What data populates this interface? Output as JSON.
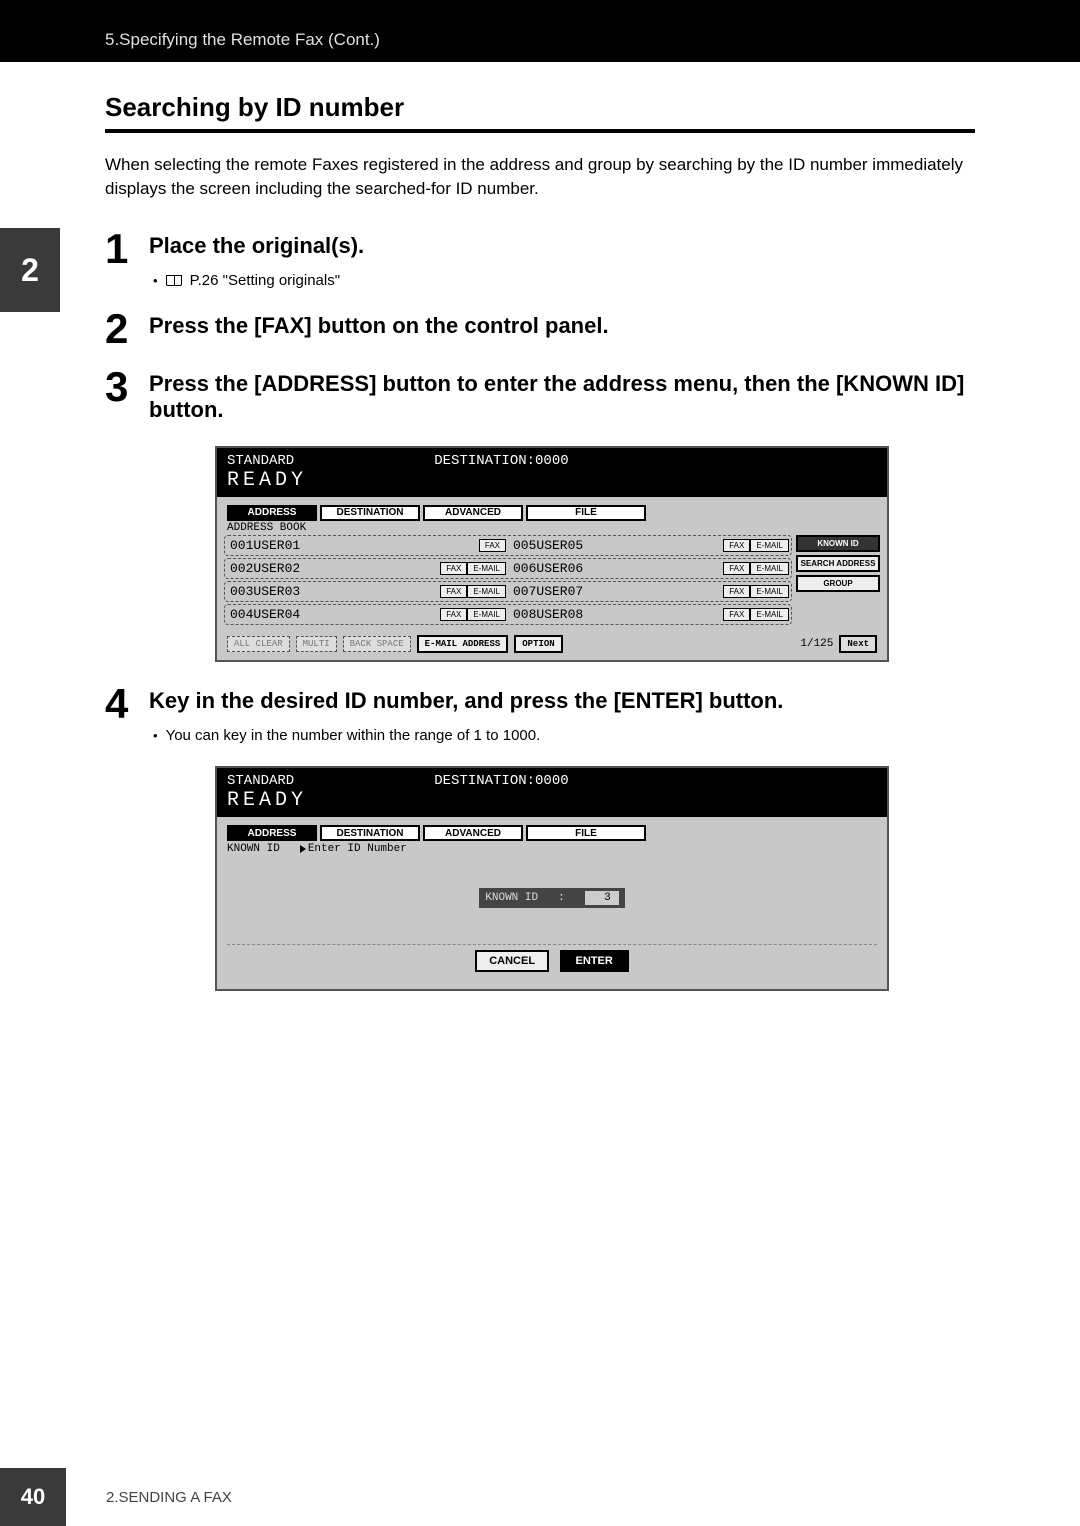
{
  "header": {
    "breadcrumb": "5.Specifying the Remote Fax (Cont.)"
  },
  "section": {
    "number": "2",
    "title": "Searching by ID number",
    "intro": "When selecting the remote Faxes registered in the address and group by searching by the ID number immediately displays the screen including the searched-for ID number."
  },
  "steps": {
    "s1": {
      "num": "1",
      "text": "Place the original(s).",
      "sub_ref": "P.26 \"Setting originals\""
    },
    "s2": {
      "num": "2",
      "text": "Press the [FAX] button on the control panel."
    },
    "s3": {
      "num": "3",
      "text": "Press the [ADDRESS] button to enter the address menu, then the [KNOWN ID] button."
    },
    "s4": {
      "num": "4",
      "text": "Key in the desired ID number, and press the [ENTER] button.",
      "sub_note": "You can key in the number within the range of 1 to 1000."
    }
  },
  "screen1": {
    "standard": "STANDARD",
    "destination": "DESTINATION:0000",
    "ready": "READY",
    "tabs": {
      "address": "ADDRESS",
      "destination_tab": "DESTINATION",
      "advanced": "ADVANCED",
      "file": "FILE"
    },
    "book_label": "ADDRESS BOOK",
    "rows": [
      {
        "left_id": "001",
        "left_name": "USER01",
        "left_fax": "FAX",
        "left_email": "",
        "right_id": "005",
        "right_name": "USER05",
        "right_fax": "FAX",
        "right_email": "E-MAIL"
      },
      {
        "left_id": "002",
        "left_name": "USER02",
        "left_fax": "FAX",
        "left_email": "E-MAIL",
        "right_id": "006",
        "right_name": "USER06",
        "right_fax": "FAX",
        "right_email": "E-MAIL"
      },
      {
        "left_id": "003",
        "left_name": "USER03",
        "left_fax": "FAX",
        "left_email": "E-MAIL",
        "right_id": "007",
        "right_name": "USER07",
        "right_fax": "FAX",
        "right_email": "E-MAIL"
      },
      {
        "left_id": "004",
        "left_name": "USER04",
        "left_fax": "FAX",
        "left_email": "E-MAIL",
        "right_id": "008",
        "right_name": "USER08",
        "right_fax": "FAX",
        "right_email": "E-MAIL"
      }
    ],
    "side": {
      "known_id": "KNOWN ID",
      "search_address": "SEARCH ADDRESS",
      "group": "GROUP"
    },
    "footer": {
      "all_clear": "ALL CLEAR",
      "multi": "MULTI",
      "back_space": "BACK SPACE",
      "email_address": "E-MAIL ADDRESS",
      "option": "OPTION",
      "page": "1/125",
      "next": "Next"
    }
  },
  "screen2": {
    "standard": "STANDARD",
    "destination": "DESTINATION:0000",
    "ready": "READY",
    "tabs": {
      "address": "ADDRESS",
      "destination_tab": "DESTINATION",
      "advanced": "ADVANCED",
      "file": "FILE"
    },
    "known_label": "KNOWN ID",
    "enter_hint": "Enter ID Number",
    "known_id_label": "KNOWN ID",
    "colon": ":",
    "value": "3",
    "cancel": "CANCEL",
    "enter": "ENTER"
  },
  "footer": {
    "page_number": "40",
    "chapter": "2.SENDING A FAX"
  }
}
